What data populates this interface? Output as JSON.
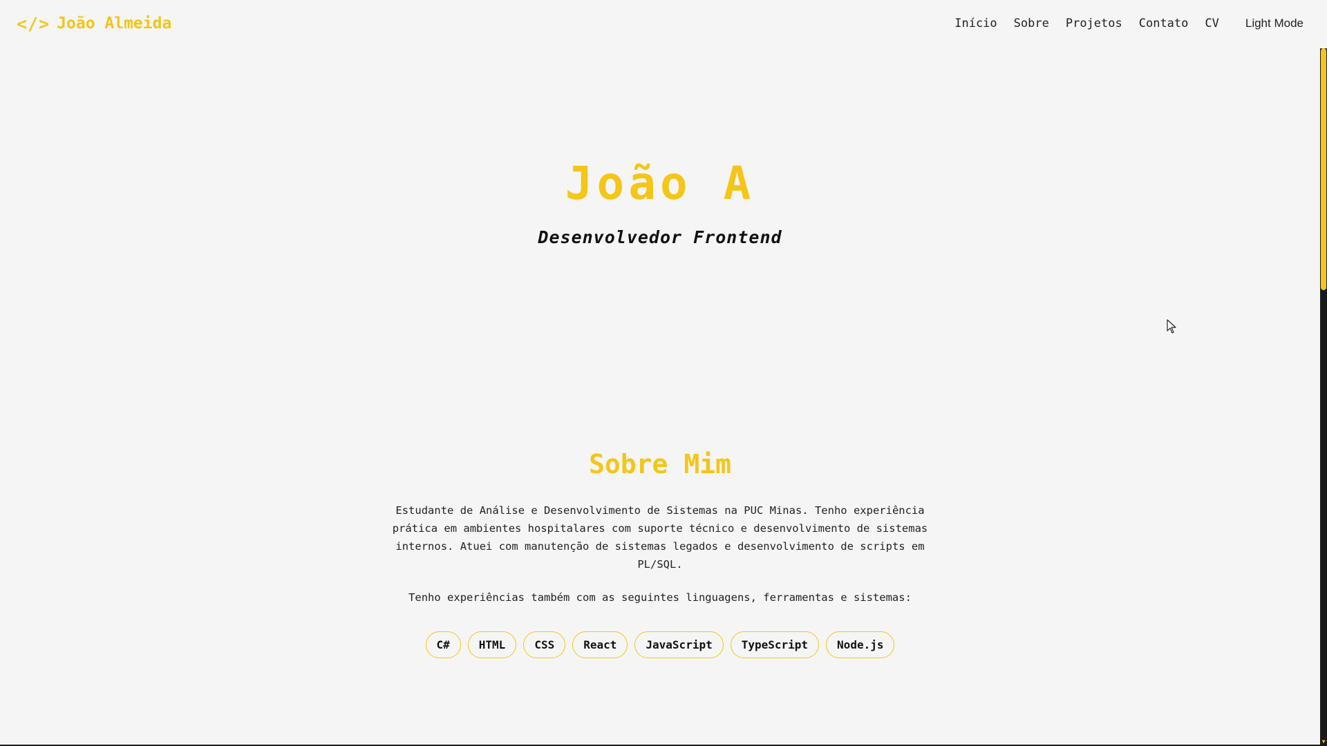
{
  "header": {
    "brand_icon": "</>",
    "brand_name": "João Almeida",
    "nav": [
      "Início",
      "Sobre",
      "Projetos",
      "Contato",
      "CV"
    ],
    "theme_toggle": "Light Mode"
  },
  "hero": {
    "name": "João A",
    "role": "Desenvolvedor Frontend"
  },
  "about": {
    "title": "Sobre Mim",
    "paragraph1": "Estudante de Análise e Desenvolvimento de Sistemas na PUC Minas. Tenho experiência prática em ambientes hospitalares com suporte técnico e desenvolvimento de sistemas internos. Atuei com manutenção de sistemas legados e desenvolvimento de scripts em PL/SQL.",
    "paragraph2": "Tenho experiências também com as seguintes linguagens, ferramentas e sistemas:",
    "skills": [
      "C#",
      "HTML",
      "CSS",
      "React",
      "JavaScript",
      "TypeScript",
      "Node.js"
    ]
  },
  "colors": {
    "accent": "#f5c518",
    "background": "#f5f5f5",
    "text": "#111111"
  }
}
